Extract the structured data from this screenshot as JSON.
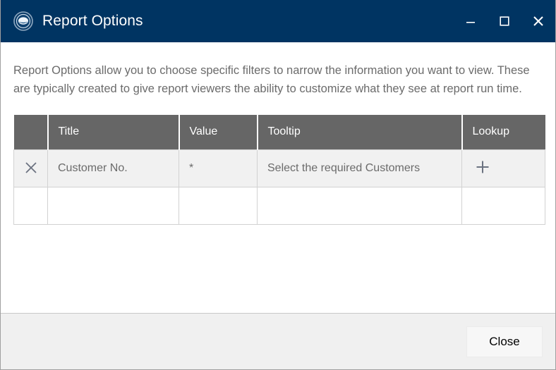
{
  "window": {
    "title": "Report Options",
    "icon": "app-disc-icon",
    "accent_color": "#003462",
    "controls": [
      {
        "name": "minimize",
        "label": "Minimize"
      },
      {
        "name": "maximize",
        "label": "Maximize"
      },
      {
        "name": "close",
        "label": "Close"
      }
    ]
  },
  "content": {
    "description": "Report Options allow you to choose specific filters to narrow the information you want to view. These are typically created to give report viewers the ability to customize what they see at report run time."
  },
  "table": {
    "header_bg": "#666666",
    "columns": [
      {
        "key": "action",
        "label": ""
      },
      {
        "key": "title",
        "label": "Title"
      },
      {
        "key": "value",
        "label": "Value"
      },
      {
        "key": "tooltip",
        "label": "Tooltip"
      },
      {
        "key": "lookup",
        "label": "Lookup"
      }
    ],
    "rows": [
      {
        "action_icon": "close-x-icon",
        "title": "Customer No.",
        "value": "*",
        "tooltip": "Select the required Customers",
        "lookup_icon": "plus-icon"
      },
      {
        "action_icon": "",
        "title": "",
        "value": "",
        "tooltip": "",
        "lookup_icon": ""
      }
    ]
  },
  "footer": {
    "close_label": "Close"
  }
}
